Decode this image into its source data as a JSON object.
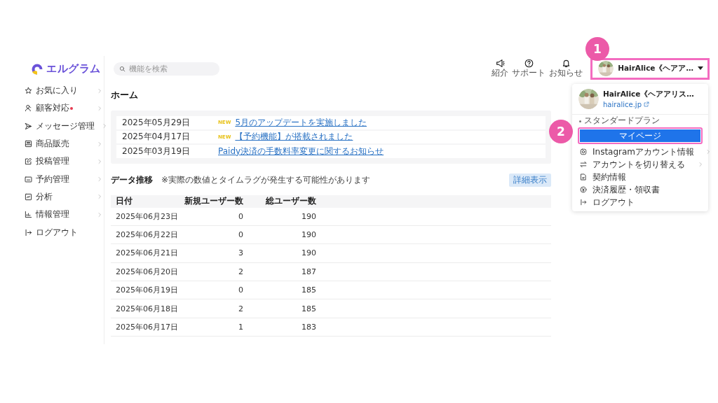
{
  "logo": {
    "text": "エルグラム"
  },
  "sidebar": {
    "items": [
      {
        "label": "お気に入り",
        "alert": false
      },
      {
        "label": "顧客対応",
        "alert": true
      },
      {
        "label": "メッセージ管理",
        "alert": false
      },
      {
        "label": "商品販売",
        "alert": false
      },
      {
        "label": "投稿管理",
        "alert": false
      },
      {
        "label": "予約管理",
        "alert": false
      },
      {
        "label": "分析",
        "alert": false
      },
      {
        "label": "情報管理",
        "alert": false
      },
      {
        "label": "ログアウト",
        "alert": false
      }
    ]
  },
  "search": {
    "placeholder": "機能を検索"
  },
  "header_icons": [
    {
      "label": "紹介"
    },
    {
      "label": "サポート"
    },
    {
      "label": "お知らせ"
    }
  ],
  "account": {
    "name": "HairAlice《ヘアア…"
  },
  "page_title": "ホーム",
  "notices": [
    {
      "date": "2025年05月29日",
      "badge": "NEW",
      "title": "5月のアップデートを実施しました"
    },
    {
      "date": "2025年04月17日",
      "badge": "NEW",
      "title": "【予約機能】が搭載されました"
    },
    {
      "date": "2025年03月19日",
      "title": "Paidy決済の手数料率変更に関するお知らせ"
    }
  ],
  "data_section": {
    "title": "データ推移",
    "note": "※実際の数値とタイムラグが発生する可能性があります",
    "button": "詳細表示"
  },
  "table": {
    "columns": [
      "日付",
      "新規ユーザー数",
      "総ユーザー数"
    ],
    "rows": [
      [
        "2025年06月23日",
        "0",
        "190"
      ],
      [
        "2025年06月22日",
        "0",
        "190"
      ],
      [
        "2025年06月21日",
        "3",
        "190"
      ],
      [
        "2025年06月20日",
        "2",
        "187"
      ],
      [
        "2025年06月19日",
        "0",
        "185"
      ],
      [
        "2025年06月18日",
        "2",
        "185"
      ],
      [
        "2025年06月17日",
        "1",
        "183"
      ]
    ]
  },
  "menu": {
    "name": "HairAlice《ヘアアリス…",
    "site": "hairalice.jp",
    "plan": "スタンダードプラン",
    "primary_button": "マイページ",
    "items": [
      {
        "label": "Instagramアカウント情報",
        "submenu": true
      },
      {
        "label": "アカウントを切り替える",
        "submenu": true
      },
      {
        "label": "契約情報",
        "submenu": false
      },
      {
        "label": "決済履歴・領収書",
        "submenu": false
      },
      {
        "label": "ログアウト",
        "submenu": false
      }
    ]
  },
  "annotations": [
    {
      "label": "1"
    },
    {
      "label": "2"
    }
  ]
}
